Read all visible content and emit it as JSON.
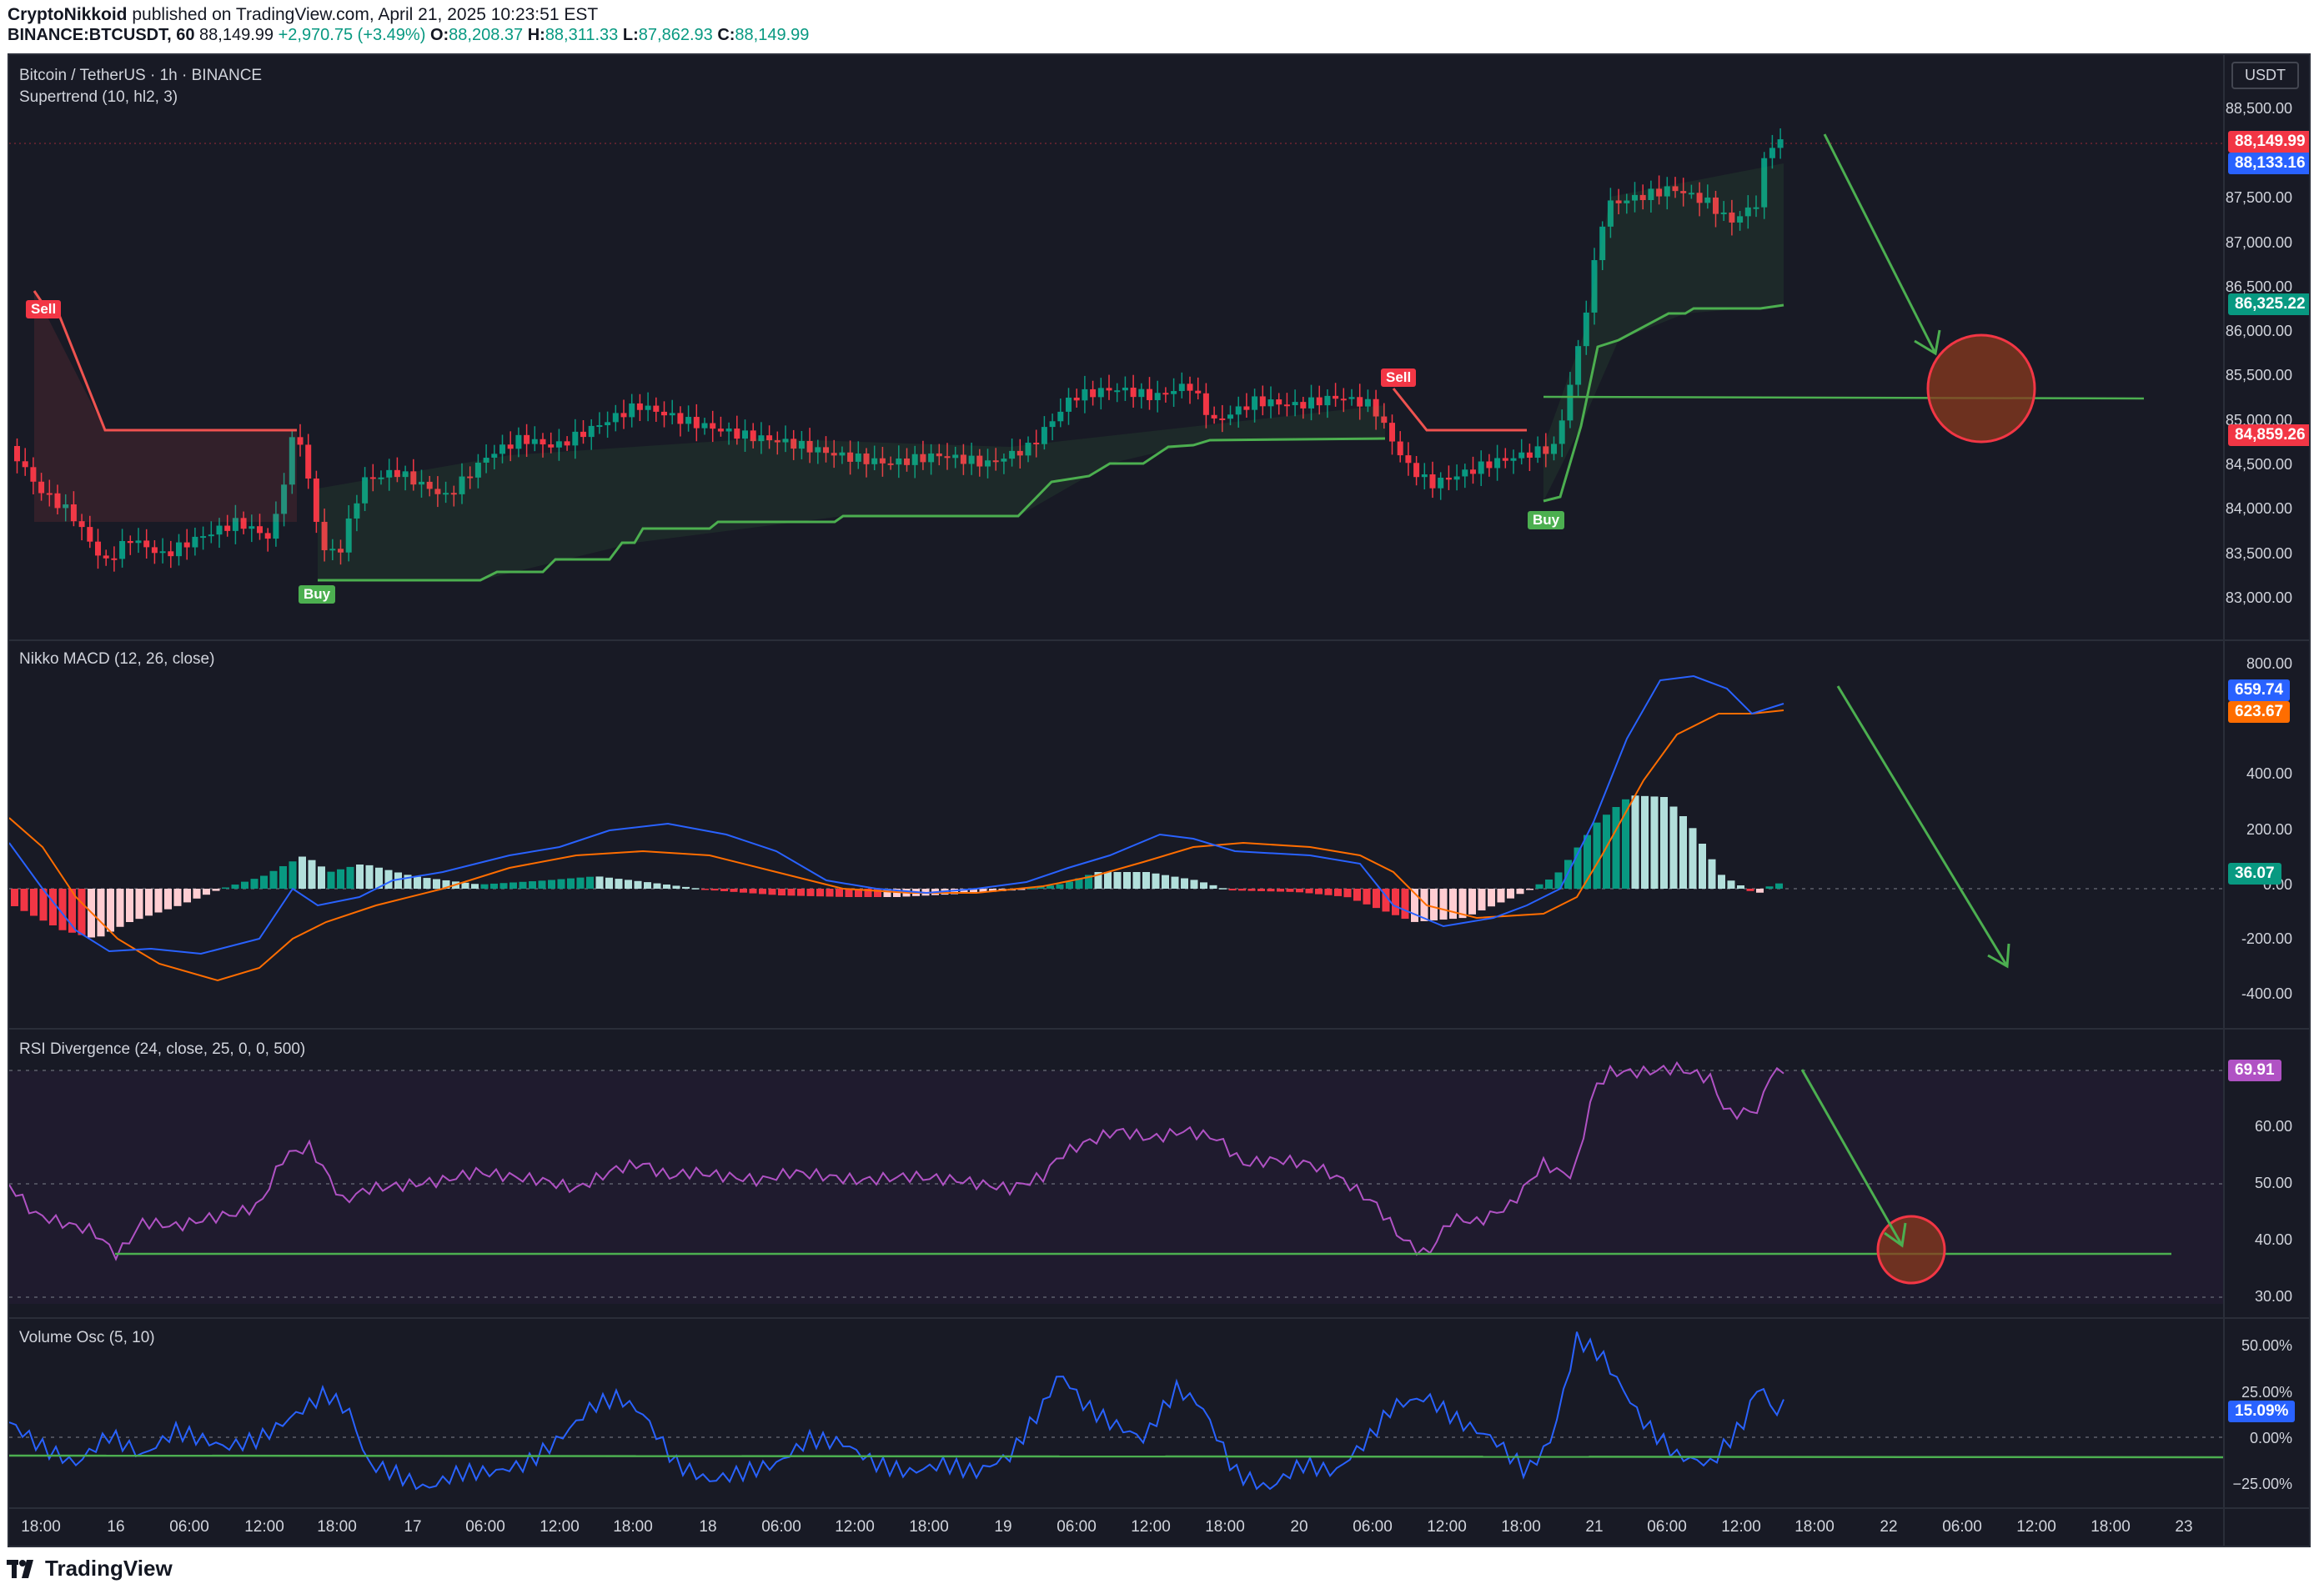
{
  "header": {
    "author": "CryptoNikkoid",
    "published_text": "published on TradingView.com, April 21, 2025 10:23:51 EST",
    "symbol": "BINANCE:BTCUSDT, 60",
    "last_price": "88,149.99",
    "change": "+2,970.75 (+3.49%)",
    "o_label": "O:",
    "o_value": "88,208.37",
    "h_label": "H:",
    "h_value": "88,311.33",
    "l_label": "L:",
    "l_value": "87,862.93",
    "c_label": "C:",
    "c_value": "88,149.99"
  },
  "main_chart": {
    "title": "Bitcoin / TetherUS · 1h · BINANCE",
    "indicator": "Supertrend (10, hl2, 3)",
    "currency_button": "USDT",
    "y_ticks": [
      "88,500.00",
      "88,000.00",
      "87,500.00",
      "87,000.00",
      "86,500.00",
      "86,000.00",
      "85,500.00",
      "85,000.00",
      "84,500.00",
      "84,000.00",
      "83,500.00",
      "83,000.00"
    ],
    "price_tags": {
      "last": "88,149.99",
      "bid": "88,133.16",
      "support": "86,325.22",
      "resistance": "84,859.26"
    },
    "signals": {
      "sell_1": "Sell",
      "buy_1": "Buy",
      "sell_2": "Sell",
      "buy_2": "Buy"
    }
  },
  "macd": {
    "title": "Nikko MACD (12, 26, close)",
    "y_ticks": [
      "800.00",
      "400.00",
      "200.00",
      "0.00",
      "-200.00",
      "-400.00"
    ],
    "tags": {
      "macd": "659.74",
      "signal": "623.67",
      "hist": "36.07"
    }
  },
  "rsi": {
    "title": "RSI Divergence (24, close, 25, 0, 0, 500)",
    "y_ticks": [
      "60.00",
      "50.00",
      "40.00",
      "30.00"
    ],
    "tags": {
      "rsi": "69.91"
    }
  },
  "volume_osc": {
    "title": "Volume Osc (5, 10)",
    "y_ticks": [
      "50.00%",
      "25.00%",
      "0.00%",
      "−25.00%"
    ],
    "tags": {
      "vo": "15.09%"
    }
  },
  "x_axis": [
    "18:00",
    "16",
    "06:00",
    "12:00",
    "18:00",
    "17",
    "06:00",
    "12:00",
    "18:00",
    "18",
    "06:00",
    "12:00",
    "18:00",
    "19",
    "06:00",
    "12:00",
    "18:00",
    "20",
    "06:00",
    "12:00",
    "18:00",
    "21",
    "06:00",
    "12:00",
    "18:00",
    "22",
    "06:00",
    "12:00",
    "18:00",
    "23"
  ],
  "footer": {
    "brand": "TradingView"
  },
  "colors": {
    "background": "#181a25",
    "up": "#089981",
    "down": "#f23645",
    "supertrend_up": "#4caf50",
    "supertrend_down": "#ef5350",
    "macd_line": "#2962ff",
    "signal_line": "#ff6d00",
    "rsi_line": "#b052c4",
    "volume_osc_line": "#2962ff",
    "annotation": "#4caf50"
  }
}
